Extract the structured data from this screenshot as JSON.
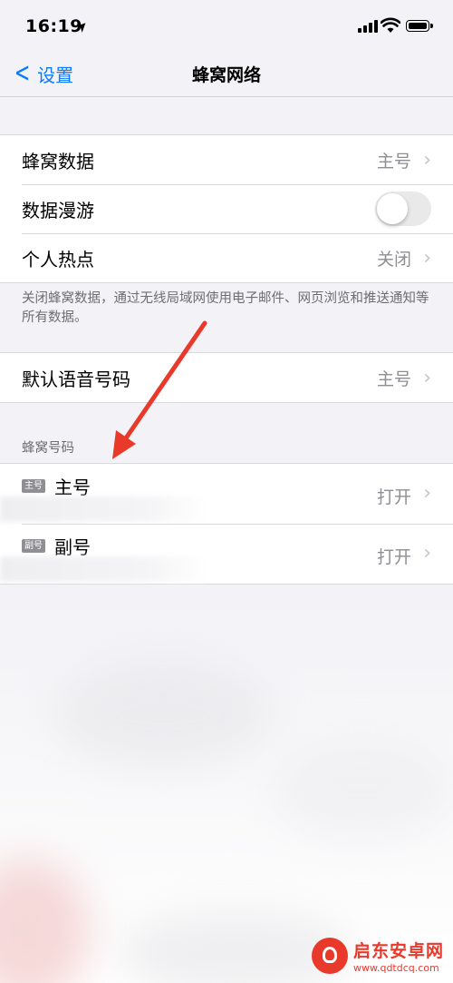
{
  "status": {
    "time": "16:19"
  },
  "nav": {
    "back_label": "设置",
    "title": "蜂窝网络"
  },
  "group1": {
    "rows": [
      {
        "label": "蜂窝数据",
        "value": "主号"
      },
      {
        "label": "数据漫游",
        "toggle": false
      },
      {
        "label": "个人热点",
        "value": "关闭"
      }
    ]
  },
  "footnote": "关闭蜂窝数据，通过无线局域网使用电子邮件、网页浏览和推送通知等所有数据。",
  "group2": {
    "label": "默认语音号码",
    "value": "主号"
  },
  "sim_section": {
    "header": "蜂窝号码",
    "rows": [
      {
        "badge": "主号",
        "label": "主号",
        "value": "打开"
      },
      {
        "badge": "副号",
        "label": "副号",
        "value": "打开"
      }
    ]
  },
  "watermark": {
    "name": "启东安卓网",
    "url": "www.qdtdcq.com"
  },
  "colors": {
    "accent": "#0a7aff",
    "annotation_arrow": "#e8392b"
  }
}
